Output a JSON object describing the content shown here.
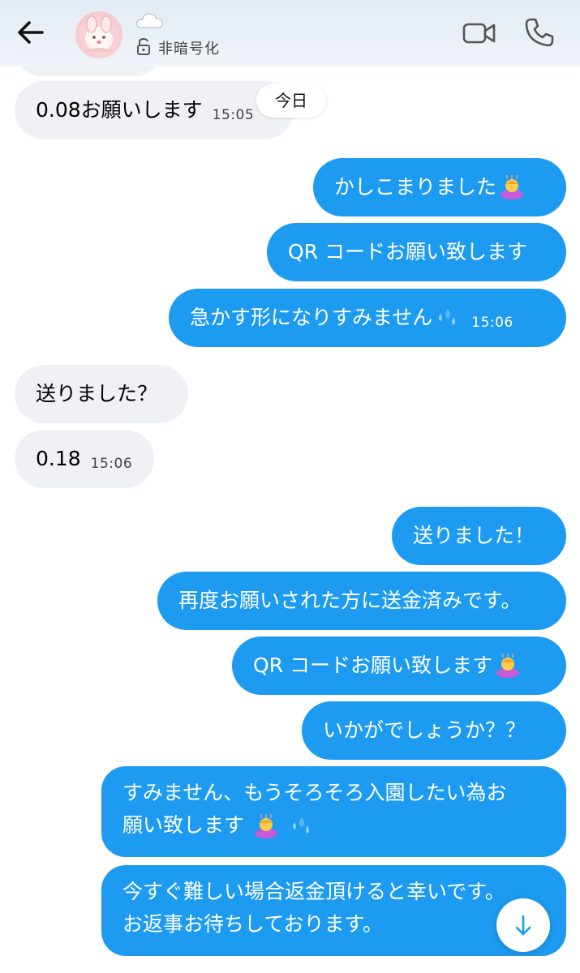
{
  "header": {
    "encryption_label": "非暗号化",
    "icons": [
      "back-arrow-icon",
      "avatar",
      "cloud-emoji",
      "lock-icon",
      "video-call-icon",
      "phone-icon"
    ]
  },
  "date_chip": "今日",
  "messages": [
    {
      "side": "in",
      "text": "0.08お願いします",
      "time": "15:05"
    },
    {
      "side": "out",
      "text": "かしこまりました",
      "emoji": "person-bowing"
    },
    {
      "side": "out",
      "text": "QR コードお願い致します"
    },
    {
      "side": "out",
      "text": "急かす形になりすみません",
      "emoji": "sweat-droplets",
      "time": "15:06"
    },
    {
      "side": "in",
      "text": "送りました？"
    },
    {
      "side": "in",
      "text": "0.18",
      "time": "15:06"
    },
    {
      "side": "out",
      "text": "送りました！"
    },
    {
      "side": "out",
      "text": "再度お願いされた方に送金済みです。"
    },
    {
      "side": "out",
      "text": "QR コードお願い致します",
      "emoji": "person-bowing"
    },
    {
      "side": "out",
      "text": "いかがでしょうか？？"
    },
    {
      "side": "out",
      "line1": "すみません、もうそろそろ入園したい為お",
      "line2": "願い致します",
      "emoji": "person-bowing",
      "emoji2": "sweat-droplets"
    },
    {
      "side": "out",
      "line1": "今すぐ難しい場合返金頂けると幸いです。",
      "line2": "お返事お待ちしております。"
    }
  ],
  "colors": {
    "outgoing_bubble": "#1d9bf0",
    "incoming_bubble": "#eff1f4",
    "header_bg": "#e7eef6"
  }
}
